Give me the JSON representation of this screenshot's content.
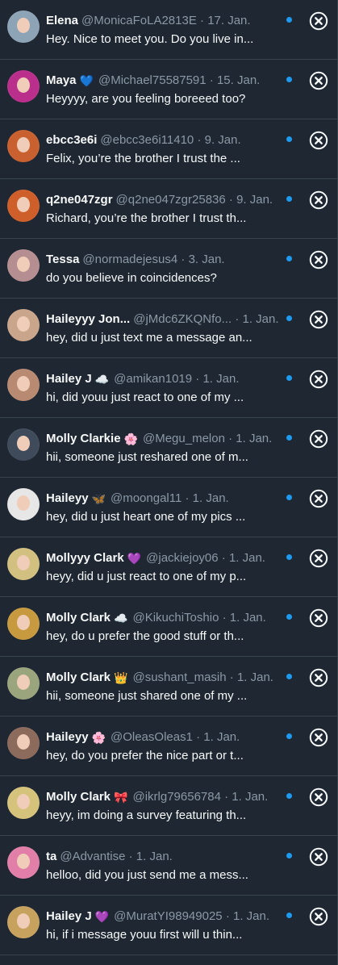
{
  "accent_color": "#1d9bf0",
  "conversations": [
    {
      "name": "Elena",
      "emoji": "",
      "handle": "@MonicaFoLA2813E",
      "date": "17. Jan.",
      "preview": "Hey. Nice to meet you. Do you live in...",
      "unread": true,
      "avatar_color": "#8da3b6"
    },
    {
      "name": "Maya",
      "emoji": "💙",
      "handle": "@Michael75587591",
      "date": "15. Jan.",
      "preview": "Heyyyy, are you feeling boreeed too?",
      "unread": true,
      "avatar_color": "#ba2f8b"
    },
    {
      "name": "ebcc3e6i",
      "emoji": "",
      "handle": "@ebcc3e6i11410",
      "date": "9. Jan.",
      "preview": "Felix, you’re the brother I trust the ...",
      "unread": true,
      "avatar_color": "#c9602f"
    },
    {
      "name": "q2ne047zgr",
      "emoji": "",
      "handle": "@q2ne047zgr25836",
      "date": "9. Jan.",
      "preview": "Richard, you’re the brother I trust th...",
      "unread": true,
      "avatar_color": "#cf5f2a"
    },
    {
      "name": "Tessa",
      "emoji": "",
      "handle": "@normadejesus4",
      "date": "3. Jan.",
      "preview": "do you believe in coincidences?",
      "unread": true,
      "avatar_color": "#b58e91"
    },
    {
      "name": "Haileyyy Jon...",
      "emoji": "",
      "handle": "@jMdc6ZKQNfo...",
      "date": "1. Jan.",
      "preview": "hey, did u just text me a message an...",
      "unread": true,
      "avatar_color": "#c9a58b"
    },
    {
      "name": "Hailey J",
      "emoji": "☁️",
      "handle": "@amikan1019",
      "date": "1. Jan.",
      "preview": "hi, did youu just react to one of my ...",
      "unread": true,
      "avatar_color": "#b98a72"
    },
    {
      "name": "Molly Clarkie",
      "emoji": "🌸",
      "handle": "@Megu_melon",
      "date": "1. Jan.",
      "preview": "hii, someone just reshared one of m...",
      "unread": true,
      "avatar_color": "#3f4a5a"
    },
    {
      "name": "Haileyy",
      "emoji": "🦋",
      "handle": "@moongal11",
      "date": "1. Jan.",
      "preview": "hey, did u just heart one of my pics ...",
      "unread": true,
      "avatar_color": "#e6e6e6"
    },
    {
      "name": "Mollyyy Clark",
      "emoji": "💜",
      "handle": "@jackiejoy06",
      "date": "1. Jan.",
      "preview": "heyy, did u just react to one of my p...",
      "unread": true,
      "avatar_color": "#d1c07f"
    },
    {
      "name": "Molly Clark",
      "emoji": "☁️",
      "handle": "@KikuchiToshio",
      "date": "1. Jan.",
      "preview": "hey, do u prefer the good stuff or th...",
      "unread": true,
      "avatar_color": "#c89a40"
    },
    {
      "name": "Molly Clark",
      "emoji": "👑",
      "handle": "@sushant_masih",
      "date": "1. Jan.",
      "preview": "hii, someone just shared one of my ...",
      "unread": true,
      "avatar_color": "#9aa47d"
    },
    {
      "name": "Haileyy",
      "emoji": "🌸",
      "handle": "@OleasOleas1",
      "date": "1. Jan.",
      "preview": "hey, do you prefer the nice part or t...",
      "unread": true,
      "avatar_color": "#8c6a5c"
    },
    {
      "name": "Molly Clark",
      "emoji": "🎀",
      "handle": "@ikrlg79656784",
      "date": "1. Jan.",
      "preview": "heyy, im doing a survey featuring th...",
      "unread": true,
      "avatar_color": "#d6c37b"
    },
    {
      "name": "ta",
      "emoji": "",
      "handle": "@Advantise",
      "date": "1. Jan.",
      "preview": "helloo, did you just send me a mess...",
      "unread": true,
      "avatar_color": "#e27fa9"
    },
    {
      "name": "Hailey J",
      "emoji": "💜",
      "handle": "@MuratYI98949025",
      "date": "1. Jan.",
      "preview": "hi, if i message youu first will u thin...",
      "unread": true,
      "avatar_color": "#c7a25f"
    }
  ]
}
